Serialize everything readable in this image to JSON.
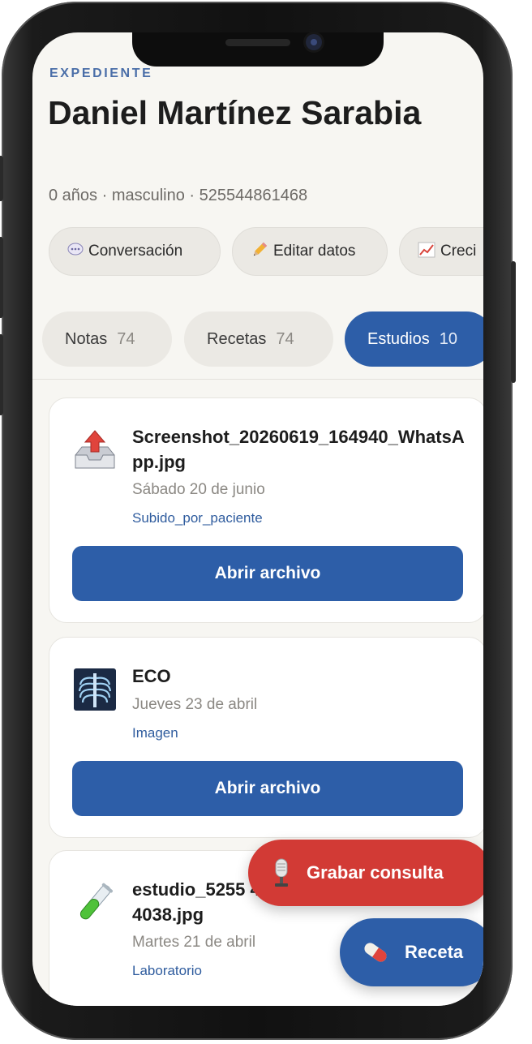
{
  "patient": {
    "section_label": "EXPEDIENTE",
    "name": "Daniel Martínez Sarabia",
    "meta": "0 años · masculino · 525544861468"
  },
  "actions": [
    {
      "icon": "speech-bubble-icon",
      "label": "Conversación"
    },
    {
      "icon": "pencil-icon",
      "label": "Editar datos"
    },
    {
      "icon": "chart-increasing-icon",
      "label": "Creci"
    }
  ],
  "tabs": [
    {
      "label": "Notas",
      "count": "74",
      "active": false
    },
    {
      "label": "Recetas",
      "count": "74",
      "active": false
    },
    {
      "label": "Estudios",
      "count": "10",
      "active": true
    }
  ],
  "studies": [
    {
      "icon": "upload-tray-icon",
      "title": "Screenshot_20260619_164940_WhatsApp.jpg",
      "date": "Sábado 20 de junio",
      "tag": "Subido_por_paciente",
      "button": "Abrir archivo"
    },
    {
      "icon": "xray-icon",
      "title": "ECO",
      "date": "Jueves 23 de abril",
      "tag": "Imagen",
      "button": "Abrir archivo"
    },
    {
      "icon": "test-tube-icon",
      "title": "estudio_5255 4214038.jpg",
      "date": "Martes 21 de abril",
      "tag": "Laboratorio"
    }
  ],
  "fabs": {
    "record": {
      "label": "Grabar consulta",
      "icon": "microphone-icon"
    },
    "prescription": {
      "label": "Receta",
      "icon": "pill-icon"
    }
  },
  "colors": {
    "primary": "#2d5ea8",
    "record": "#d23a35",
    "background": "#f7f6f2"
  }
}
